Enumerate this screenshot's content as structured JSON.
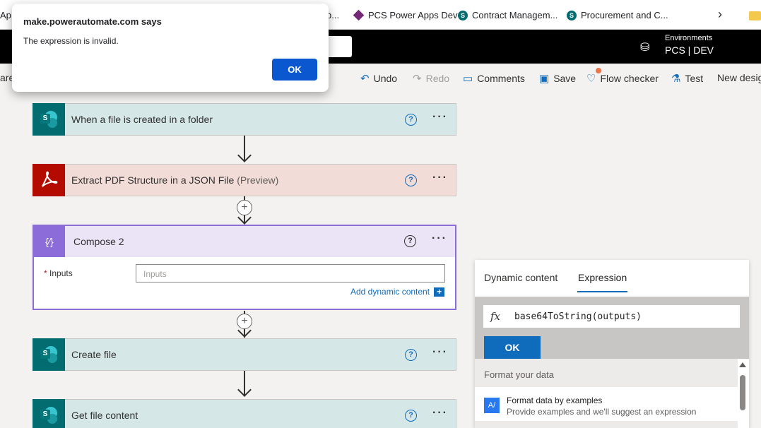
{
  "bookmarks": [
    {
      "label": "Ap"
    },
    {
      "label": "b..."
    },
    {
      "label": "PCS Power Apps Dev"
    },
    {
      "label": "Contract Managem..."
    },
    {
      "label": "Procurement and C..."
    }
  ],
  "header": {
    "env_label": "Environments",
    "env_name": "PCS | DEV"
  },
  "commands": {
    "left_partial": "are",
    "undo": "Undo",
    "redo": "Redo",
    "comments": "Comments",
    "save": "Save",
    "flow_checker": "Flow checker",
    "test": "Test",
    "new_designer": "New desig"
  },
  "flow": {
    "step1": {
      "title": "When a file is created in a folder"
    },
    "step2": {
      "title": "Extract PDF Structure in a JSON File",
      "suffix": "(Preview)"
    },
    "compose": {
      "title": "Compose 2",
      "inputs_label": "Inputs",
      "inputs_required": "*",
      "inputs_placeholder": "Inputs",
      "add_dynamic": "Add dynamic content"
    },
    "step4": {
      "title": "Create file"
    },
    "step5": {
      "title": "Get file content"
    }
  },
  "expression_panel": {
    "tab_dynamic": "Dynamic content",
    "tab_expression": "Expression",
    "fx": "fx",
    "expression": "base64ToString(outputs)",
    "ok": "OK",
    "format_header": "Format your data",
    "format_item_title": "Format data by examples",
    "format_item_sub": "Provide examples and we'll suggest an expression"
  },
  "dialog": {
    "title": "make.powerautomate.com says",
    "message": "The expression is invalid.",
    "ok": "OK"
  },
  "colors": {
    "accent": "#0f6cbd",
    "sharepoint": "#036c70",
    "pdf": "#b30b00",
    "compose": "#8c6cd9"
  }
}
